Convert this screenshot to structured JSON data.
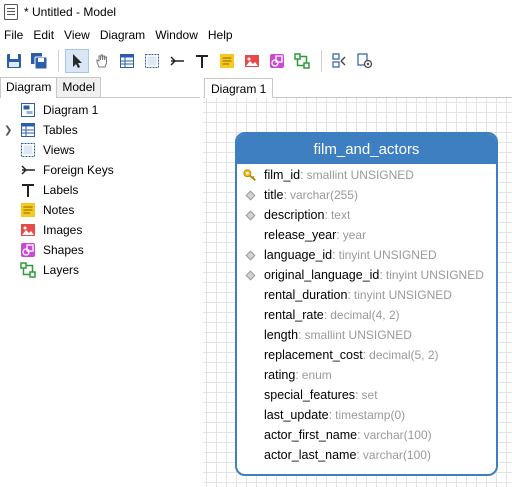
{
  "window": {
    "title": "* Untitled - Model"
  },
  "menu": [
    "File",
    "Edit",
    "View",
    "Diagram",
    "Window",
    "Help"
  ],
  "toolbar": {
    "icons": [
      "save-icon",
      "save-all-icon",
      "pointer-icon",
      "hand-icon",
      "table-icon",
      "view-icon",
      "foreign-key-icon",
      "label-icon",
      "note-icon",
      "image-icon",
      "shape-icon",
      "layer-icon",
      "generate-sql-icon",
      "settings-icon"
    ]
  },
  "left_panel": {
    "tabs": [
      "Diagram",
      "Model"
    ],
    "selected_tab": "Diagram",
    "tree": [
      {
        "label": "Diagram 1",
        "icon": "diagram-icon",
        "expandable": false
      },
      {
        "label": "Tables",
        "icon": "table-icon",
        "expandable": true
      },
      {
        "label": "Views",
        "icon": "view-icon",
        "expandable": false
      },
      {
        "label": "Foreign Keys",
        "icon": "foreign-key-icon",
        "expandable": false
      },
      {
        "label": "Labels",
        "icon": "label-icon",
        "expandable": false
      },
      {
        "label": "Notes",
        "icon": "note-icon",
        "expandable": false
      },
      {
        "label": "Images",
        "icon": "image-icon",
        "expandable": false
      },
      {
        "label": "Shapes",
        "icon": "shape-icon",
        "expandable": false
      },
      {
        "label": "Layers",
        "icon": "layer-icon",
        "expandable": false
      }
    ]
  },
  "editor": {
    "tab": "Diagram 1",
    "entity": {
      "name": "film_and_actors",
      "header_color": "#3d7fc1",
      "columns": [
        {
          "name": "film_id",
          "type": "smallint UNSIGNED",
          "marker": "key"
        },
        {
          "name": "title",
          "type": "varchar(255)",
          "marker": "index"
        },
        {
          "name": "description",
          "type": "text",
          "marker": "index"
        },
        {
          "name": "release_year",
          "type": "year",
          "marker": "none"
        },
        {
          "name": "language_id",
          "type": "tinyint UNSIGNED",
          "marker": "index"
        },
        {
          "name": "original_language_id",
          "type": "tinyint UNSIGNED",
          "marker": "index"
        },
        {
          "name": "rental_duration",
          "type": "tinyint UNSIGNED",
          "marker": "none"
        },
        {
          "name": "rental_rate",
          "type": "decimal(4, 2)",
          "marker": "none"
        },
        {
          "name": "length",
          "type": "smallint UNSIGNED",
          "marker": "none"
        },
        {
          "name": "replacement_cost",
          "type": "decimal(5, 2)",
          "marker": "none"
        },
        {
          "name": "rating",
          "type": "enum",
          "marker": "none"
        },
        {
          "name": "special_features",
          "type": "set",
          "marker": "none"
        },
        {
          "name": "last_update",
          "type": "timestamp(0)",
          "marker": "none"
        },
        {
          "name": "actor_first_name",
          "type": "varchar(100)",
          "marker": "none"
        },
        {
          "name": "actor_last_name",
          "type": "varchar(100)",
          "marker": "none"
        }
      ]
    }
  }
}
